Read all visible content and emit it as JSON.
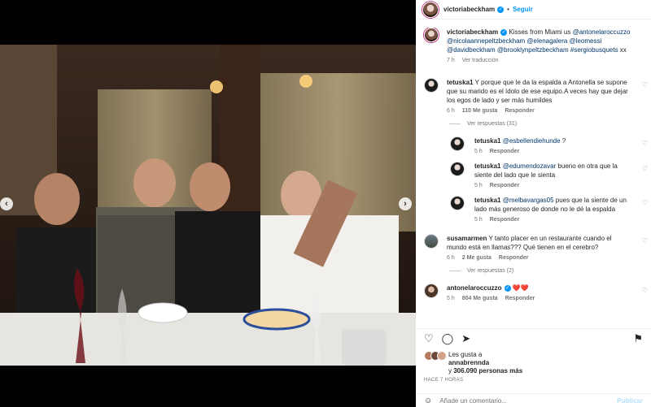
{
  "post": {
    "author": "victoriabeckham",
    "follow_label": "Seguir",
    "dot": "•"
  },
  "caption": {
    "author": "victoriabeckham",
    "text": " Kisses from Miami us ",
    "mentions": "@antonelaroccuzzo @nicolaannepeltzbeckham @elenagalera @leomessi @davidbeckham @brooklynpeltzbeckham #sergiobusquets",
    "suffix": " xx",
    "time": "7 h",
    "translate": "Ver traducción"
  },
  "comments": [
    {
      "user": "tetuska1",
      "text": " Y porque que le da la espalda a Antonella se supone que su marido es el ídolo de ese equipo.A veces hay que dejar los egos de lado y ser más humildes",
      "time": "6 h",
      "likes": "110 Me gusta",
      "reply": "Responder",
      "view_replies": "Ver respuestas (31)"
    },
    {
      "user": "tetuska1",
      "mention": "@esbellendiehunde",
      "text": " ?",
      "time": "5 h",
      "reply": "Responder"
    },
    {
      "user": "tetuska1",
      "mention": "@edumendozavar",
      "text": " bueno en otra que la siente del lado que le sienta",
      "time": "5 h",
      "reply": "Responder"
    },
    {
      "user": "tetuska1",
      "mention": "@melbavargas05",
      "text": " pues que la siente de un lado más generoso de donde no le dé la espalda",
      "time": "5 h",
      "reply": "Responder"
    },
    {
      "user": "susamarmen",
      "text": " Y tanto placer en un restaurante cuando el mundo está en llamas??? Qué tienen en el cerebro?",
      "time": "6 h",
      "likes": "2 Me gusta",
      "reply": "Responder",
      "view_replies": "Ver respuestas (2)"
    },
    {
      "user": "antonelaroccuzzo",
      "text": " ❤️❤️",
      "time": "5 h",
      "likes": "804 Me gusta",
      "reply": "Responder"
    }
  ],
  "likes": {
    "line1_prefix": "Les gusta a",
    "first_user": "annabrennda",
    "line2_prefix": "y ",
    "count": "306.090 personas más"
  },
  "ago": "HACE 7 HORAS",
  "add_comment": {
    "placeholder": "Añade un comentario...",
    "post": "Publicar"
  },
  "icons": {
    "heart": "♡",
    "like": "♡",
    "comment": "◯",
    "share": "➤",
    "save": "⚑",
    "emoji": "☺",
    "prev": "‹",
    "next": "›",
    "verified": "✓"
  }
}
